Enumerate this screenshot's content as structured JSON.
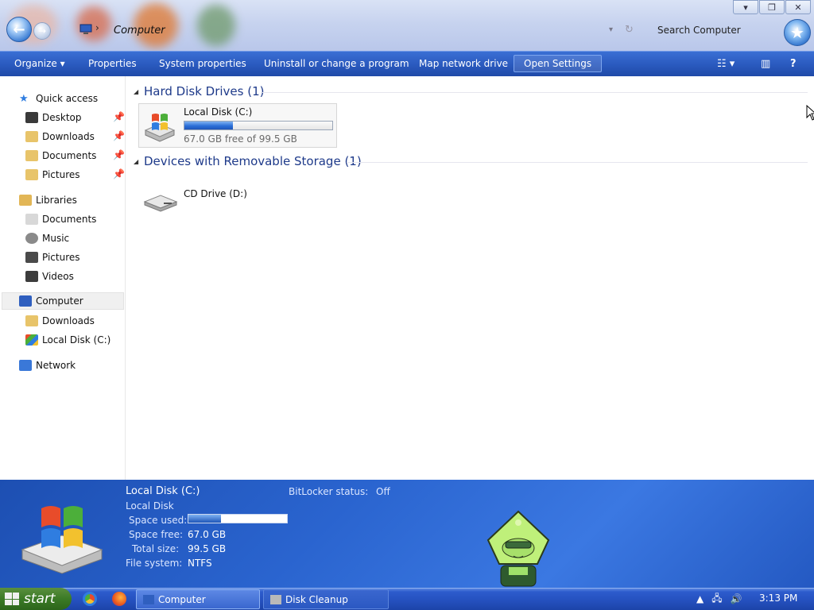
{
  "window": {
    "address": "Computer",
    "search_placeholder": "Search Computer",
    "controls": {
      "minimize": "▾",
      "maximize": "❐",
      "close": "✕"
    }
  },
  "commands": {
    "organize": "Organize ▾",
    "properties": "Properties",
    "system_properties": "System properties",
    "uninstall": "Uninstall or change a program",
    "map_drive": "Map network drive",
    "open_settings": "Open Settings",
    "help": "?"
  },
  "sidebar": {
    "quick_access": "Quick access",
    "quick_items": [
      "Desktop",
      "Downloads",
      "Documents",
      "Pictures"
    ],
    "libraries": "Libraries",
    "library_items": [
      "Documents",
      "Music",
      "Pictures",
      "Videos"
    ],
    "computer": "Computer",
    "computer_items": [
      "Downloads",
      "Local Disk (C:)"
    ],
    "network": "Network"
  },
  "main": {
    "hdd_group": "Hard Disk Drives (1)",
    "local_disk": {
      "name": "Local Disk (C:)",
      "free_text": "67.0 GB free of 99.5 GB",
      "used_fraction": 0.327
    },
    "removable_group": "Devices with Removable Storage (1)",
    "cd_drive": {
      "name": "CD Drive (D:)"
    }
  },
  "details": {
    "title": "Local Disk (C:)",
    "type": "Local Disk",
    "bitlocker_label": "BitLocker status:",
    "bitlocker_value": "Off",
    "space_used_label": "Space used:",
    "space_used_fraction": 0.327,
    "space_free_label": "Space free:",
    "space_free_value": "67.0 GB",
    "total_size_label": "Total size:",
    "total_size_value": "99.5 GB",
    "file_system_label": "File system:",
    "file_system_value": "NTFS"
  },
  "taskbar": {
    "start": "start",
    "buttons": [
      "Computer",
      "Disk Cleanup"
    ],
    "clock": "3:13 PM"
  },
  "colors": {
    "command_bar": "#2b5bc0",
    "details_pane": "#2a64cf",
    "taskbar": "#244fbd",
    "start_green": "#3b7a26",
    "group_heading": "#1e3a8a"
  }
}
